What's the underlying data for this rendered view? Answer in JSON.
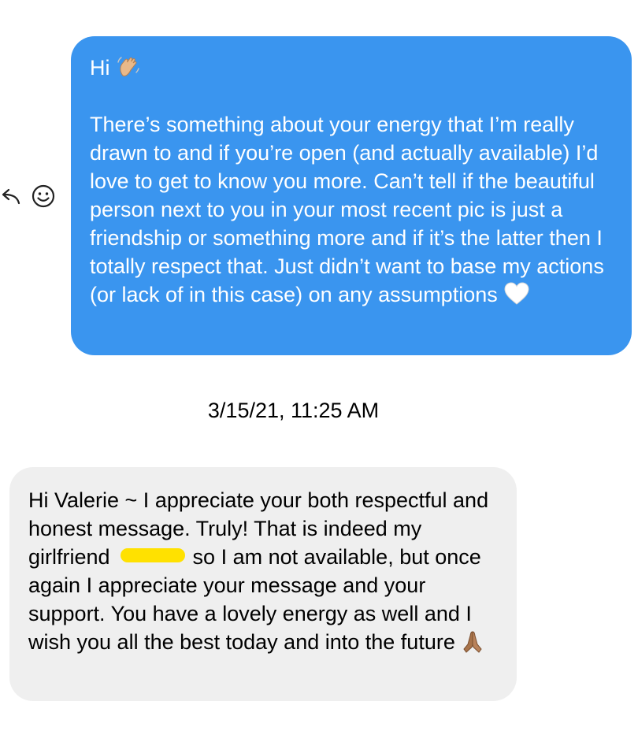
{
  "outgoing": {
    "greeting": "Hi ",
    "wave_icon": "waving-hand-icon",
    "body": "There’s something about your energy that I’m really drawn to and if you’re open (and actually available) I’d love to get to know you more. Can’t tell if the beautiful person next to you in your most recent pic is just a friendship or something more and if it’s the latter then I totally respect that. Just didn’t want to base my actions (or lack of in this case) on any assumptions ",
    "end_icon": "white-heart-icon",
    "color": "#3a95ef"
  },
  "actions": {
    "reply_icon": "reply-arrow-icon",
    "react_icon": "smiley-icon"
  },
  "timestamp": "3/15/21, 11:25 AM",
  "incoming": {
    "text_before_redaction": "Hi Valerie ~ I appreciate your both respectful and honest message. Truly! That is indeed my girlfriend ",
    "redaction_color": "#ffe100",
    "text_after_redaction": " so I am not available, but once again I appreciate your message and your support. You have a lovely energy as well and I wish you all the best today and into the future ",
    "end_icon": "praying-hands-icon",
    "color": "#efefef"
  }
}
